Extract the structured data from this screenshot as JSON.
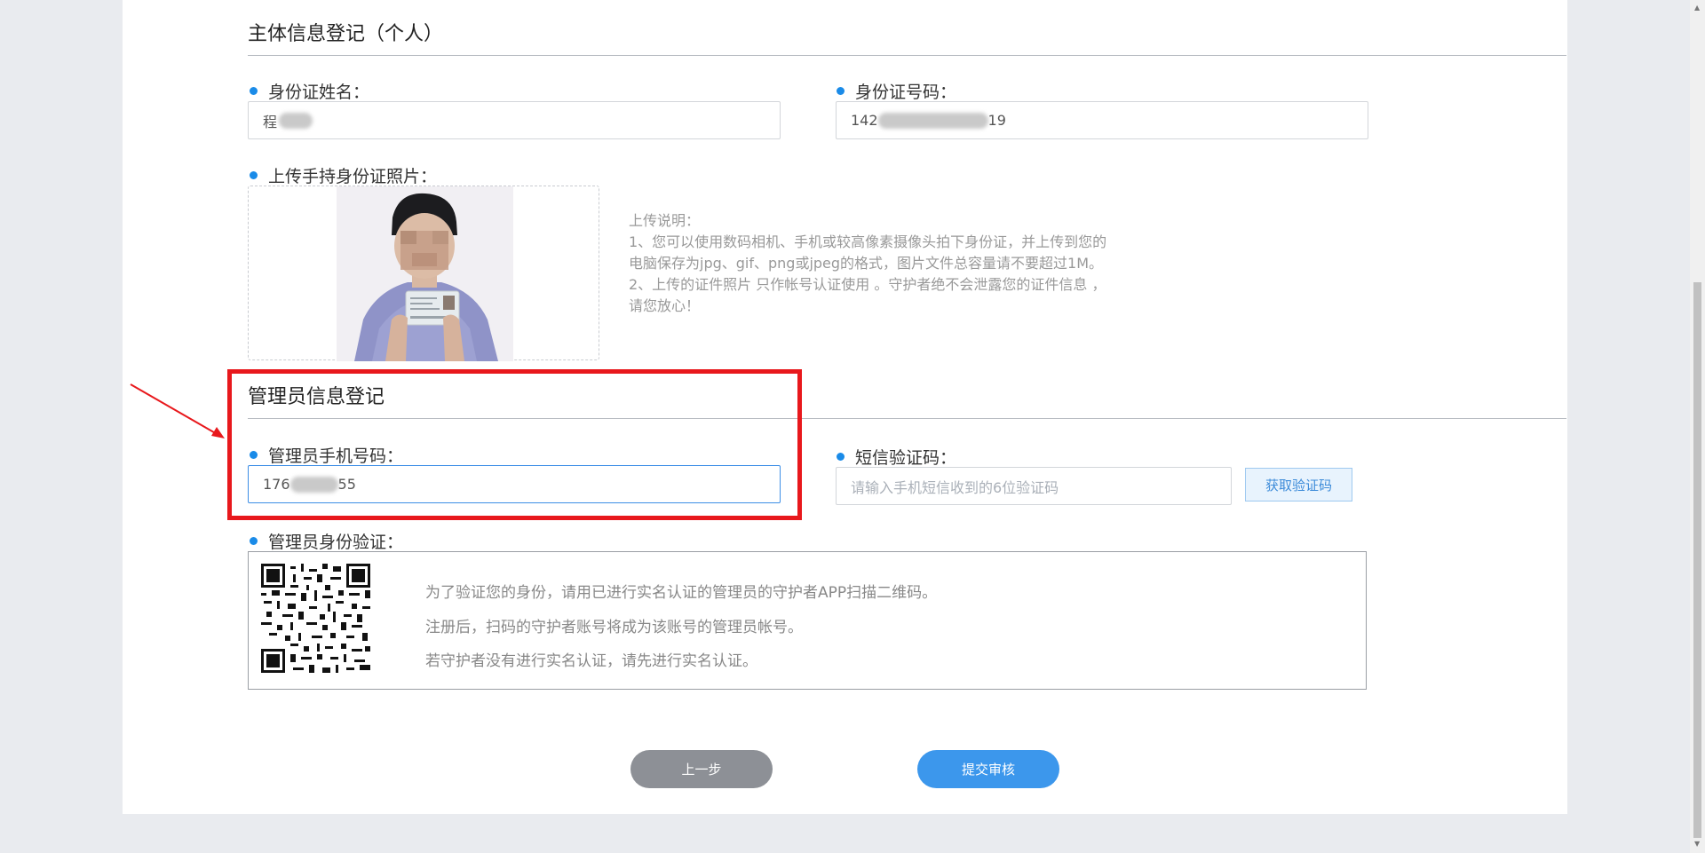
{
  "section1": {
    "title": "主体信息登记（个人）",
    "id_name_label": "身份证姓名：",
    "id_name_value": "程",
    "id_number_label": "身份证号码：",
    "id_number_prefix": "142",
    "id_number_suffix": "19",
    "upload_label": "上传手持身份证照片：",
    "upload_notes": [
      "上传说明：",
      "1、您可以使用数码相机、手机或较高像素摄像头拍下身份证，并上传到您的",
      "电脑保存为jpg、gif、png或jpeg的格式，图片文件总容量请不要超过1M。",
      "2、上传的证件照片 只作帐号认证使用 。守护者绝不会泄露您的证件信息 ，",
      "请您放心！"
    ]
  },
  "section2": {
    "title": "管理员信息登记",
    "phone_label": "管理员手机号码：",
    "phone_prefix": "176",
    "phone_suffix": "55",
    "sms_label": "短信验证码：",
    "sms_placeholder": "请输入手机短信收到的6位验证码",
    "sms_button": "获取验证码",
    "verify_label": "管理员身份验证：",
    "verify_lines": [
      "为了验证您的身份，请用已进行实名认证的管理员的守护者APP扫描二维码。",
      "注册后，扫码的守护者账号将成为该账号的管理员帐号。",
      "若守护者没有进行实名认证，请先进行实名认证。"
    ]
  },
  "actions": {
    "prev": "上一步",
    "submit": "提交审核"
  },
  "colors": {
    "accent": "#1a8be8",
    "submit_button": "#3c97ec",
    "prev_button": "#8d9096",
    "annotation_red": "#e8181c"
  },
  "icons": {
    "bullet": "blue-dot-icon",
    "qr": "qr-code-icon",
    "annotation": "red-arrow-icon"
  }
}
